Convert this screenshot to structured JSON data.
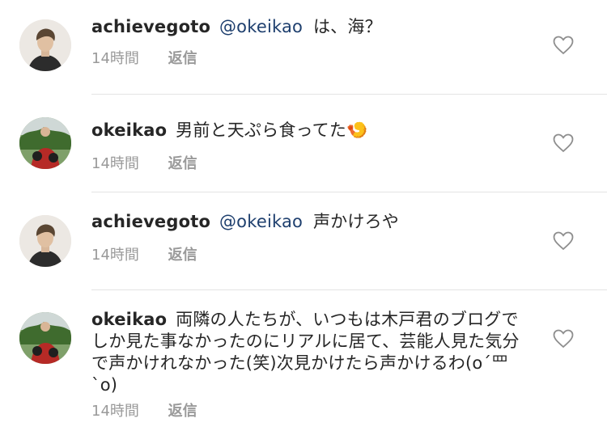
{
  "comments": [
    {
      "username": "achievegoto",
      "mention": "@okeikao",
      "text": "は、海？",
      "time": "14時間",
      "reply": "返信",
      "avatar_icon": "avatar-man-icon"
    },
    {
      "username": "okeikao",
      "mention": "",
      "text": "男前と天ぷら食ってた🍤",
      "time": "14時間",
      "reply": "返信",
      "avatar_icon": "avatar-group-icon"
    },
    {
      "username": "achievegoto",
      "mention": "@okeikao",
      "text": "声かけろや",
      "time": "14時間",
      "reply": "返信",
      "avatar_icon": "avatar-man-icon"
    },
    {
      "username": "okeikao",
      "mention": "",
      "text": "両隣の人たちが、いつもは木戸君のブログでしか見た事なかったのにリアルに居て、芸能人見た気分で声かけれなかった(笑)次見かけたら声かけるわ(o´罒`o)",
      "time": "14時間",
      "reply": "返信",
      "avatar_icon": "avatar-group-icon"
    }
  ],
  "icons": {
    "like": "heart-outline-icon"
  },
  "colors": {
    "mention": "#1e3f6e",
    "meta": "#9a9a9a",
    "divider": "#e3e3e3"
  }
}
